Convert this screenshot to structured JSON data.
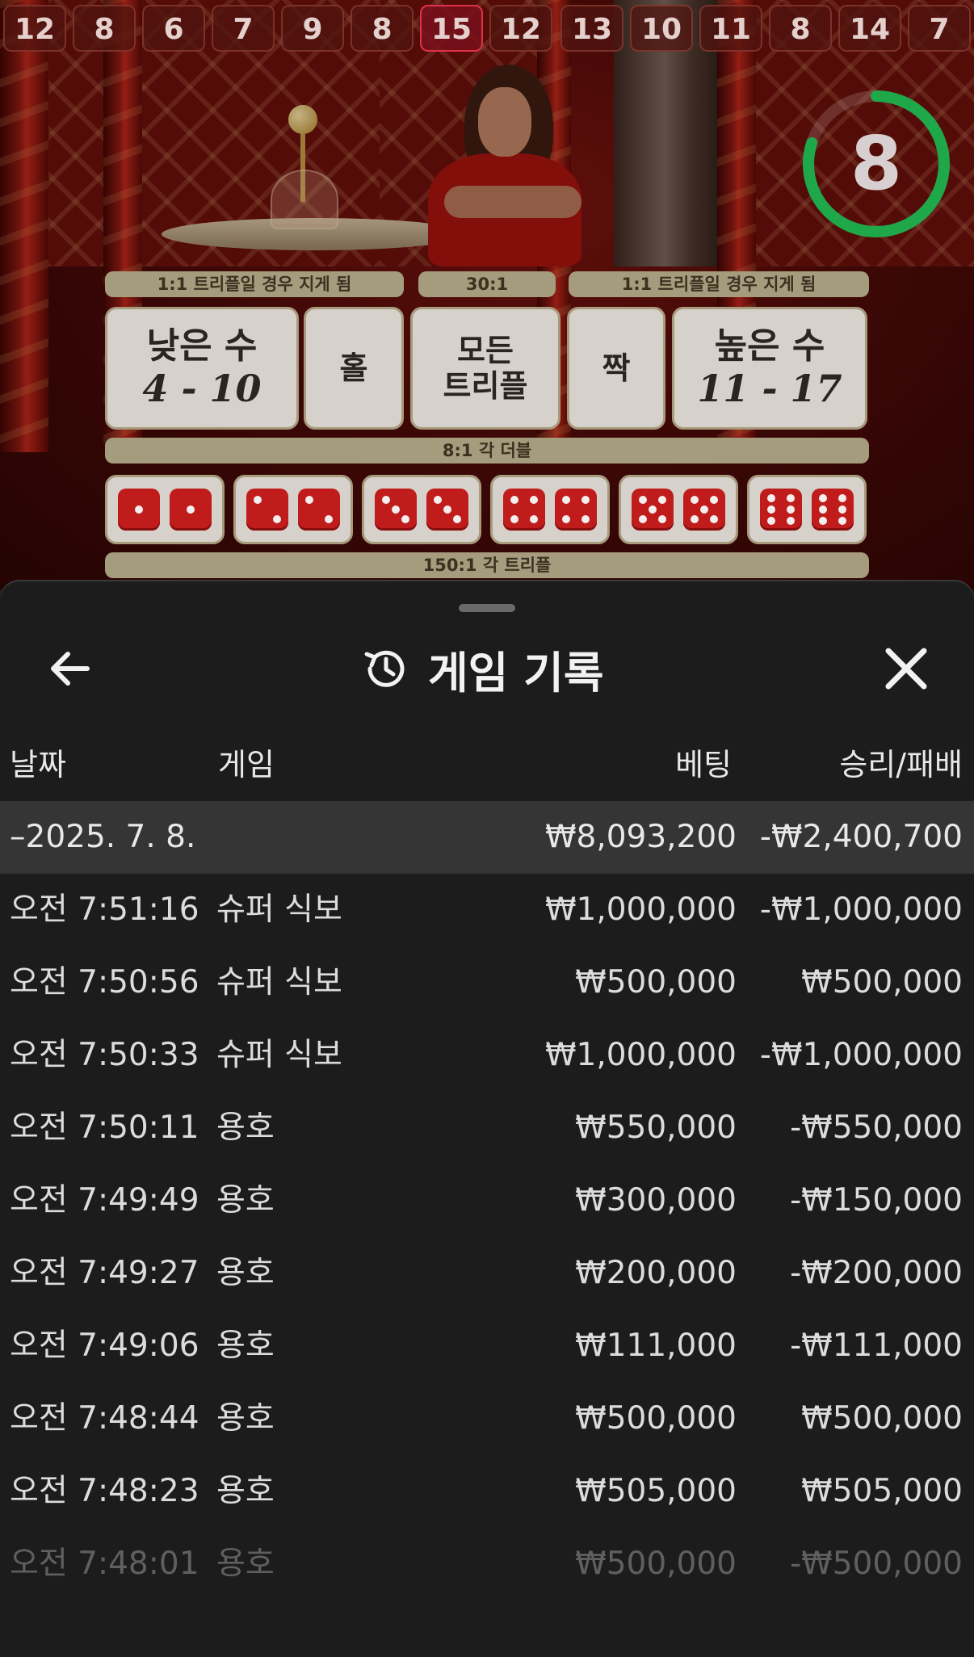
{
  "history_results": [
    "12",
    "8",
    "6",
    "7",
    "9",
    "8",
    "15",
    "12",
    "13",
    "10",
    "11",
    "8",
    "14",
    "7"
  ],
  "highlight_index": 6,
  "timer": {
    "value": "8",
    "progress": 0.8
  },
  "board": {
    "pill_low": "1:1 트리플일 경우 지게 됨",
    "pill_triple": "30:1",
    "pill_high": "1:1 트리플일 경우 지게 됨",
    "low_label": "낮은 수",
    "low_range": "4 - 10",
    "odd_label": "홀",
    "any_triple_line1": "모든",
    "any_triple_line2": "트리플",
    "even_label": "짝",
    "high_label": "높은 수",
    "high_range": "11 - 17",
    "double_pill": "8:1 각 더블",
    "triple_pill": "150:1 각 트리플",
    "doubles": [
      1,
      2,
      3,
      4,
      5,
      6
    ]
  },
  "sheet": {
    "title": "게임 기록",
    "columns": {
      "date": "날짜",
      "game": "게임",
      "bet": "베팅",
      "winloss": "승리/패배"
    },
    "group": {
      "date": "–2025. 7. 8.",
      "bet": "₩8,093,200",
      "winloss": "-₩2,400,700"
    },
    "rows": [
      {
        "time": "오전 7:51:16",
        "game": "슈퍼 식보",
        "bet": "₩1,000,000",
        "winloss": "-₩1,000,000"
      },
      {
        "time": "오전 7:50:56",
        "game": "슈퍼 식보",
        "bet": "₩500,000",
        "winloss": "₩500,000"
      },
      {
        "time": "오전 7:50:33",
        "game": "슈퍼 식보",
        "bet": "₩1,000,000",
        "winloss": "-₩1,000,000"
      },
      {
        "time": "오전 7:50:11",
        "game": "용호",
        "bet": "₩550,000",
        "winloss": "-₩550,000"
      },
      {
        "time": "오전 7:49:49",
        "game": "용호",
        "bet": "₩300,000",
        "winloss": "-₩150,000"
      },
      {
        "time": "오전 7:49:27",
        "game": "용호",
        "bet": "₩200,000",
        "winloss": "-₩200,000"
      },
      {
        "time": "오전 7:49:06",
        "game": "용호",
        "bet": "₩111,000",
        "winloss": "-₩111,000"
      },
      {
        "time": "오전 7:48:44",
        "game": "용호",
        "bet": "₩500,000",
        "winloss": "₩500,000"
      },
      {
        "time": "오전 7:48:23",
        "game": "용호",
        "bet": "₩505,000",
        "winloss": "₩505,000"
      },
      {
        "time": "오전 7:48:01",
        "game": "용호",
        "bet": "₩500,000",
        "winloss": "-₩500,000"
      }
    ]
  },
  "icons": {
    "back": "arrow-left-icon",
    "history": "history-clock-icon",
    "close": "close-icon"
  },
  "colors": {
    "timer_green": "#1fa84a",
    "die_red": "#c01c1c",
    "sheet_bg": "#1c1c1c",
    "group_bg": "#353535",
    "highlight_border": "#e0304a"
  }
}
